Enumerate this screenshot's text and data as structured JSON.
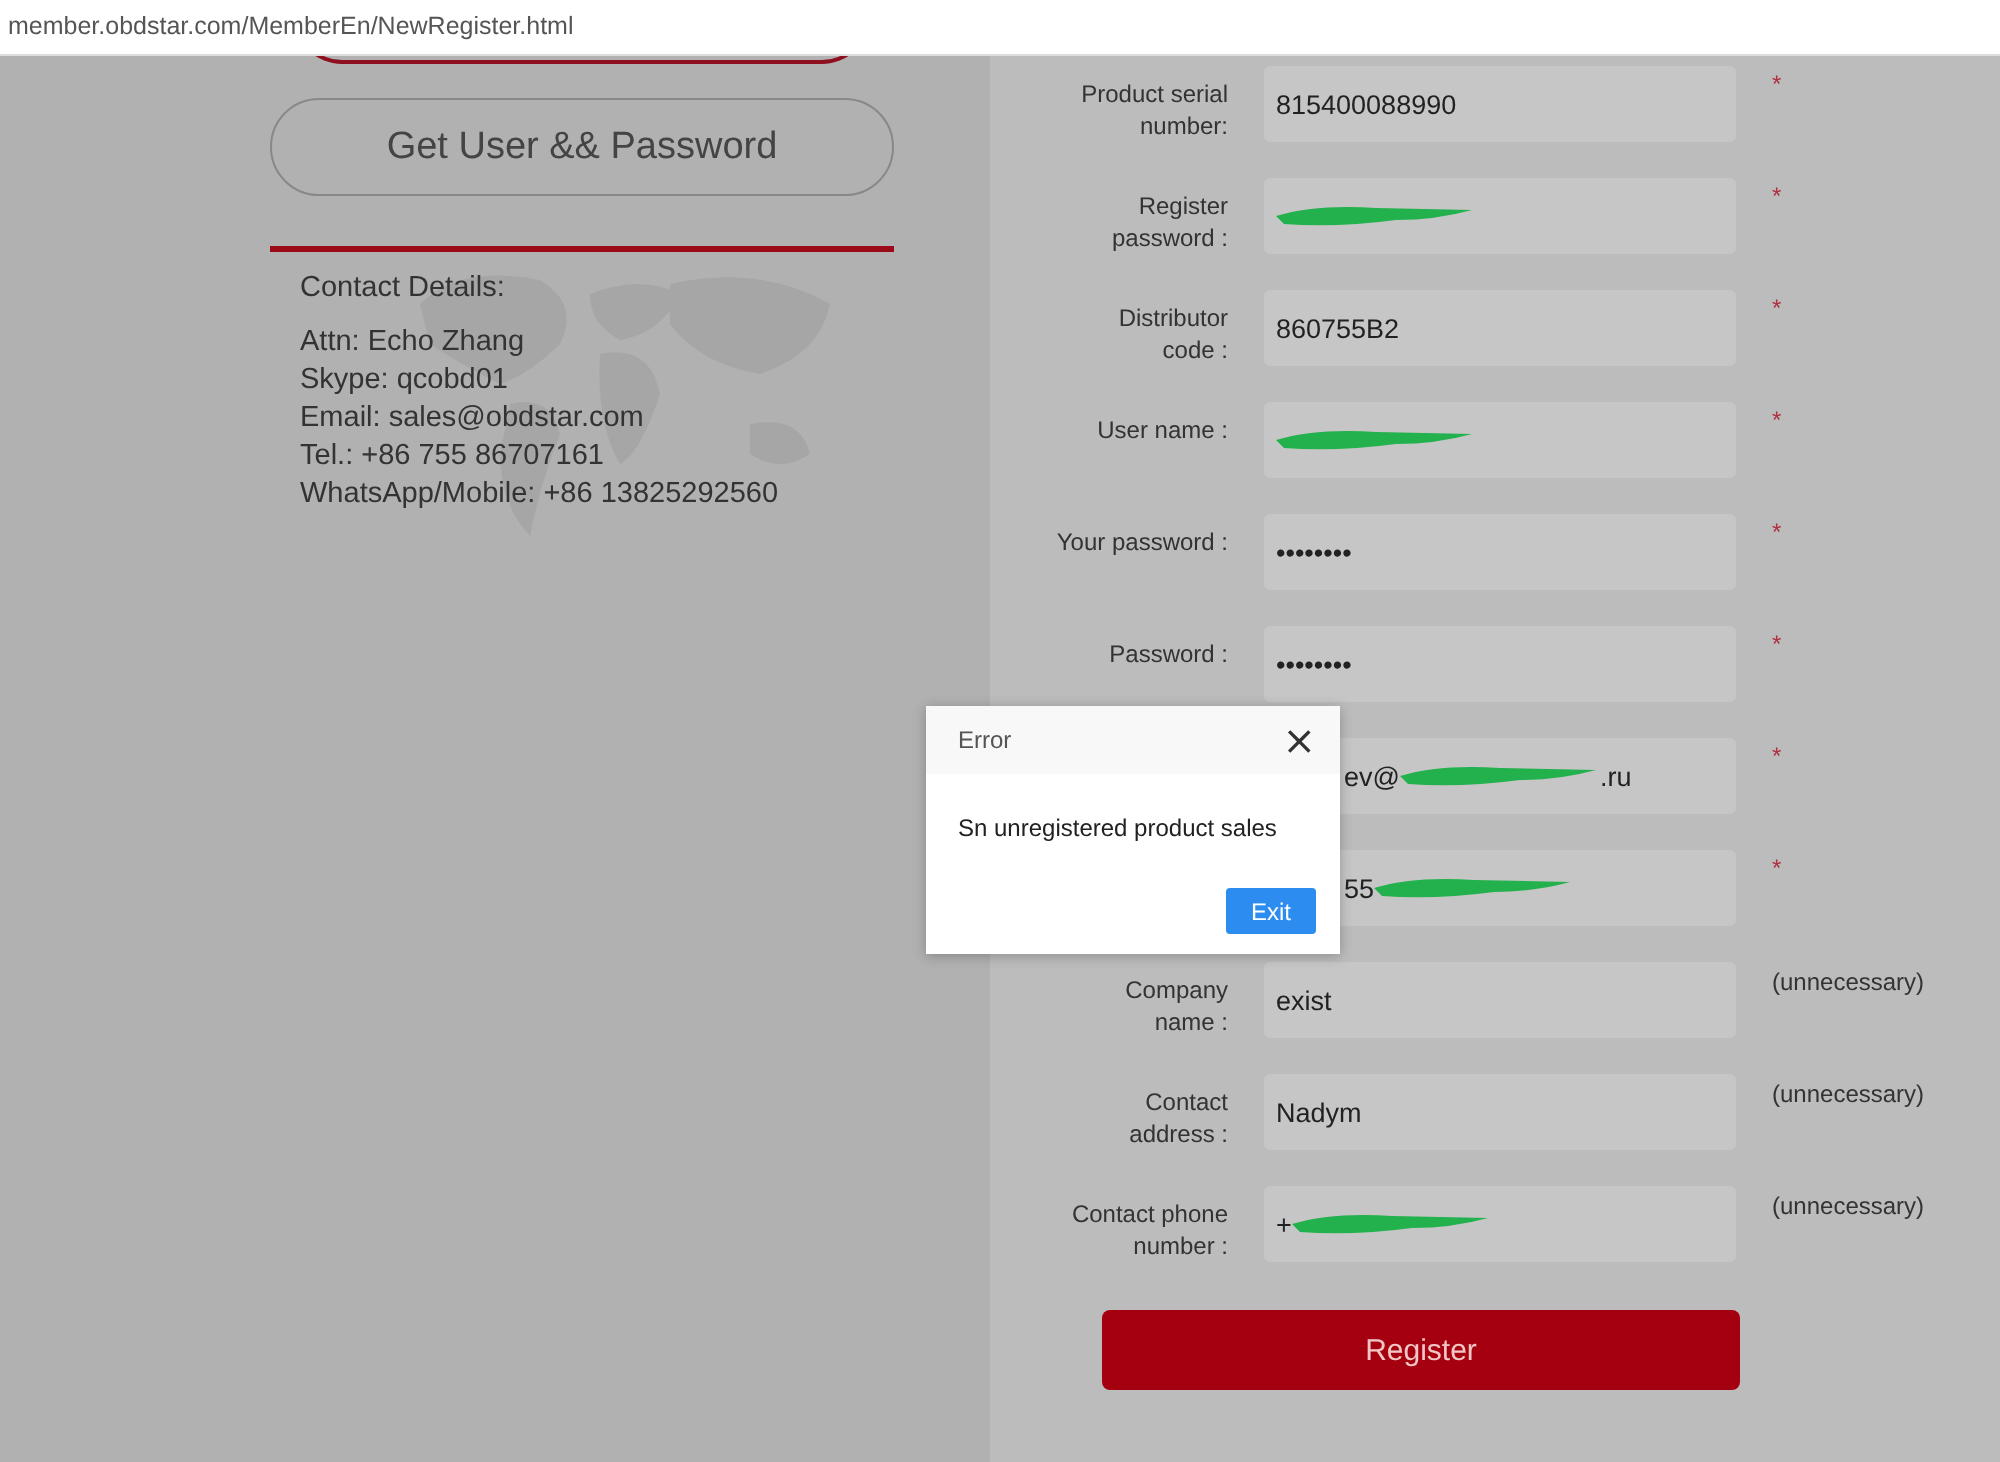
{
  "address_bar": {
    "url": "member.obdstar.com/MemberEn/NewRegister.html"
  },
  "left": {
    "get_button": "Get User && Password",
    "contact_title": "Contact Details:",
    "contact_lines": [
      "Attn: Echo Zhang",
      "Skype: qcobd01",
      "Email: sales@obdstar.com",
      "Tel.: +86 755 86707161",
      "WhatsApp/Mobile: +86 13825292560"
    ]
  },
  "form": {
    "rows": [
      {
        "label": [
          "Product serial",
          "number:"
        ],
        "value": "815400088990",
        "required_mark": "*",
        "redacted": false
      },
      {
        "label": [
          "Register",
          "password :"
        ],
        "required_mark": "*",
        "redacted": true
      },
      {
        "label": [
          "Distributor",
          "code :"
        ],
        "value": "860755B2",
        "required_mark": "*",
        "redacted": false
      },
      {
        "label": [
          "User name :"
        ],
        "required_mark": "*",
        "redacted": true
      },
      {
        "label": [
          "Your password :"
        ],
        "value": "••••••••",
        "required_mark": "*",
        "redacted": false
      },
      {
        "label": [
          "Password :"
        ],
        "value": "••••••••",
        "required_mark": "*",
        "redacted": false
      },
      {
        "value": "ev@",
        "value_suffix": ".ru",
        "required_mark": "*",
        "redacted": true
      },
      {
        "value": "55",
        "required_mark": "*",
        "redacted": true
      },
      {
        "label": [
          "Company",
          "name :"
        ],
        "value": "exist",
        "redacted": false,
        "note": "(unnecessary)"
      },
      {
        "label": [
          "Contact",
          "address :"
        ],
        "value": "Nadym",
        "redacted": false,
        "note": "(unnecessary)"
      },
      {
        "label": [
          "Contact phone",
          "number :"
        ],
        "value": "+",
        "redacted": true,
        "note": "(unnecessary)"
      }
    ],
    "submit": "Register"
  },
  "dialog": {
    "title": "Error",
    "close": "×",
    "message": "Sn unregistered product sales",
    "button": "Exit"
  }
}
